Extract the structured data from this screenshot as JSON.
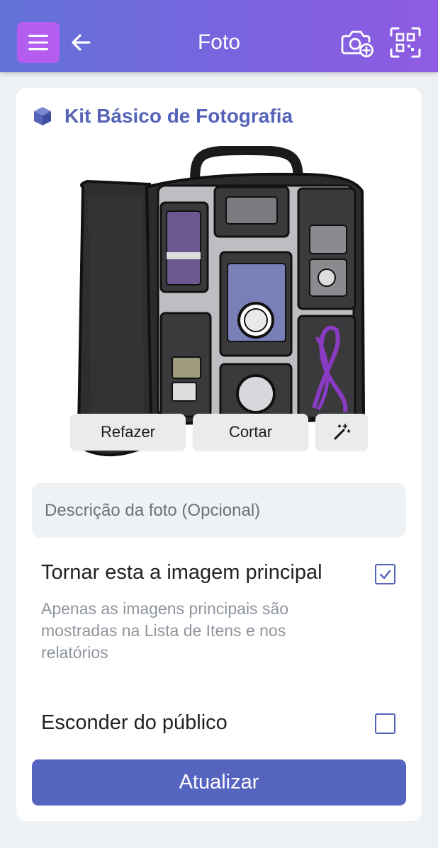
{
  "header": {
    "title": "Foto",
    "menu_icon": "hamburger-icon",
    "back_icon": "arrow-left-icon",
    "add_photo_icon": "camera-plus-icon",
    "scan_icon": "qr-scan-icon"
  },
  "item": {
    "icon": "cube-icon",
    "name": "Kit Básico de Fotografia"
  },
  "photo_actions": {
    "redo_label": "Refazer",
    "crop_label": "Cortar",
    "enhance_icon": "magic-wand-icon"
  },
  "description": {
    "value": "",
    "placeholder": "Descrição da foto (Opcional)"
  },
  "main_image": {
    "label": "Tornar esta a imagem principal",
    "checked": true,
    "hint": "Apenas as imagens principais são mostradas na Lista de Itens e nos relatórios"
  },
  "hide_public": {
    "label": "Esconder do público",
    "checked": false
  },
  "submit": {
    "label": "Atualizar"
  },
  "colors": {
    "accent": "#5564be",
    "menu_button": "#b35ef0",
    "header_gradient_start": "#6273d8",
    "header_gradient_end": "#8f5be2"
  }
}
